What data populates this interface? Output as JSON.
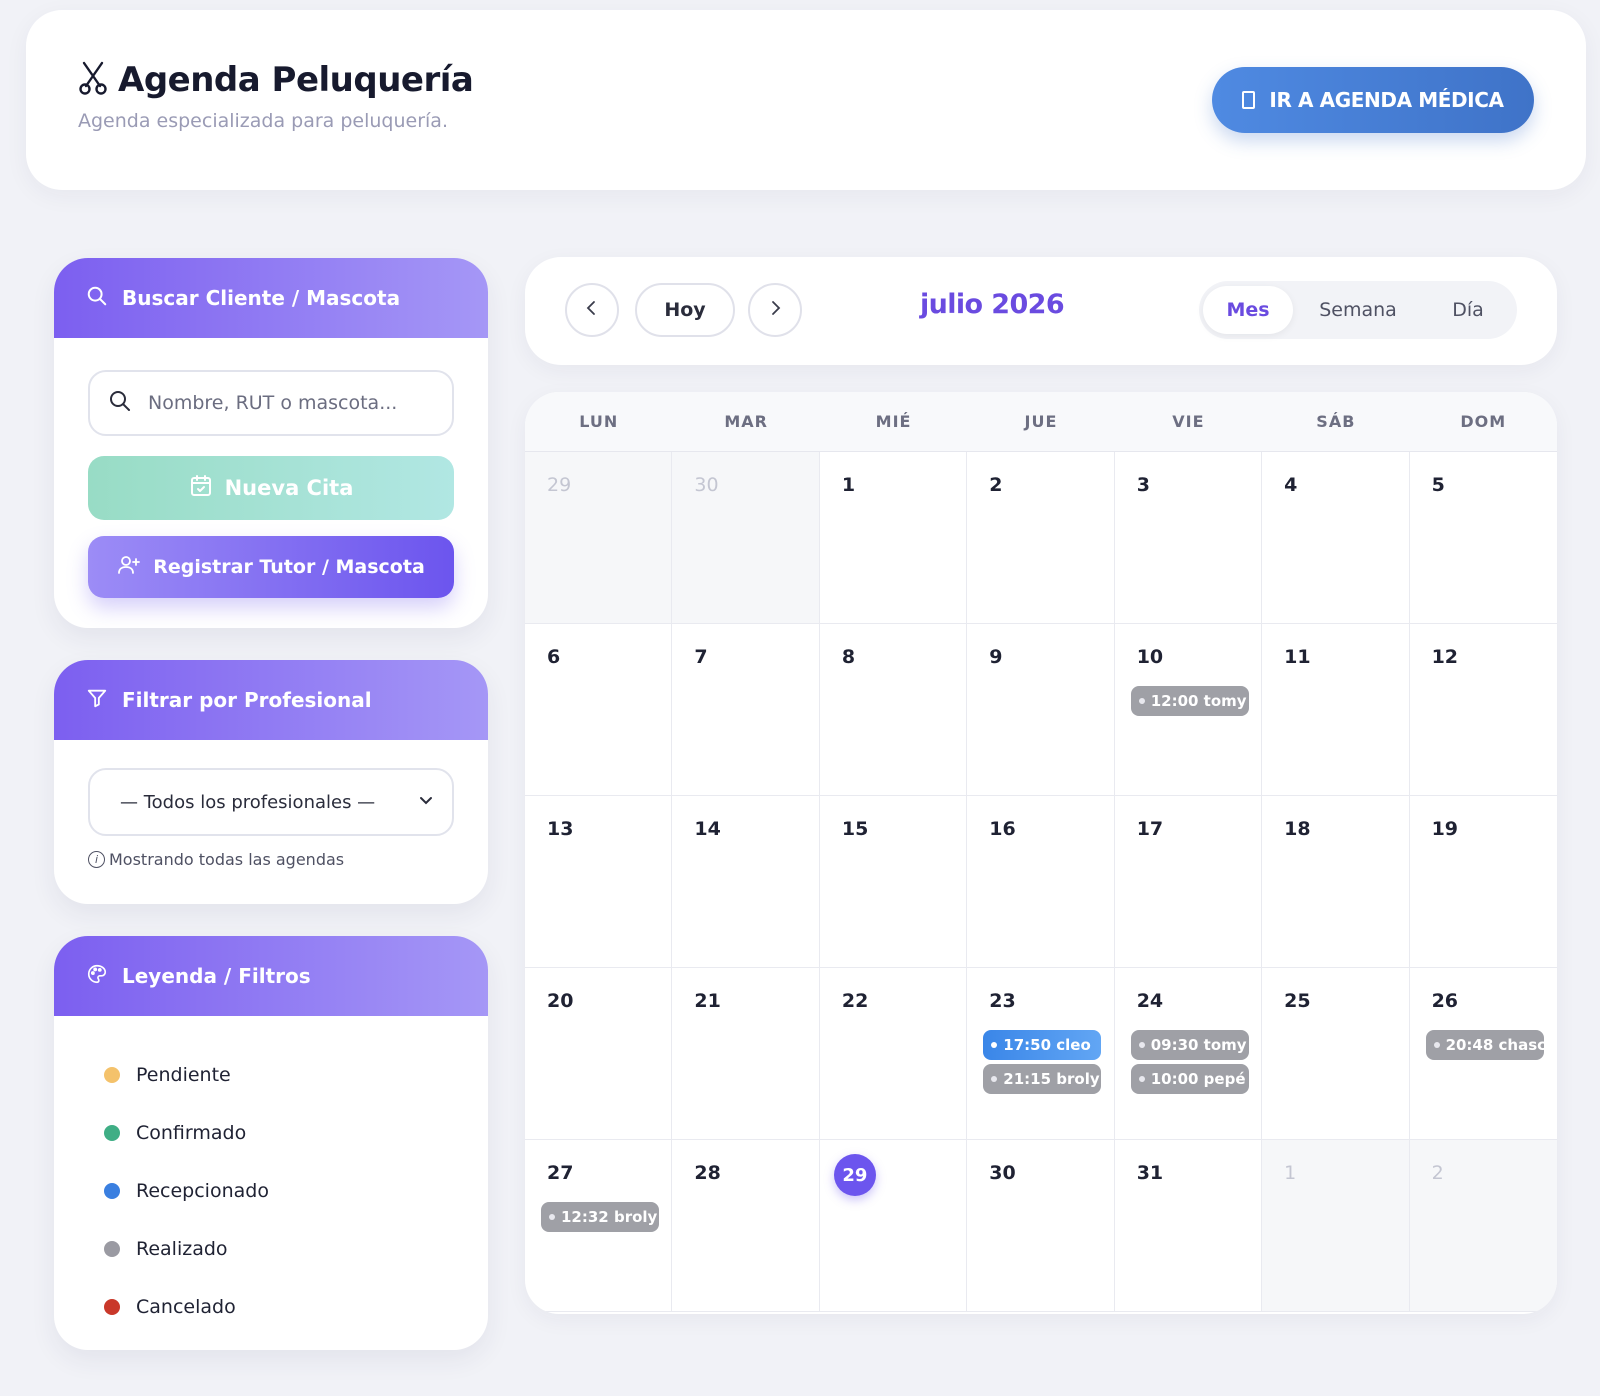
{
  "header": {
    "title": "Agenda Peluquería",
    "subtitle": "Agenda especializada para peluquería.",
    "medical_button": "IR A AGENDA MÉDICA"
  },
  "search_panel": {
    "title": "Buscar Cliente / Mascota",
    "placeholder": "Nombre, RUT o mascota...",
    "new_appointment": "Nueva Cita",
    "register": "Registrar Tutor / Mascota"
  },
  "filter_panel": {
    "title": "Filtrar por Profesional",
    "selected": "— Todos los profesionales —",
    "note": "Mostrando todas las agendas"
  },
  "legend_panel": {
    "title": "Leyenda / Filtros",
    "items": [
      {
        "label": "Pendiente",
        "color": "#f4c26b"
      },
      {
        "label": "Confirmado",
        "color": "#3fae85"
      },
      {
        "label": "Recepcionado",
        "color": "#3a7fe0"
      },
      {
        "label": "Realizado",
        "color": "#9a9aa2"
      },
      {
        "label": "Cancelado",
        "color": "#c9382a"
      }
    ]
  },
  "toolbar": {
    "today": "Hoy",
    "month_label": "julio 2026",
    "views": [
      "Mes",
      "Semana",
      "Día"
    ],
    "active_view": "Mes"
  },
  "calendar": {
    "weekdays": [
      "LUN",
      "MAR",
      "MIÉ",
      "JUE",
      "VIE",
      "SÁB",
      "DOM"
    ],
    "days": [
      "29",
      "30",
      "1",
      "2",
      "3",
      "4",
      "5",
      "6",
      "7",
      "8",
      "9",
      "10",
      "11",
      "12",
      "13",
      "14",
      "15",
      "16",
      "17",
      "18",
      "19",
      "20",
      "21",
      "22",
      "23",
      "24",
      "25",
      "26",
      "27",
      "28",
      "29",
      "30",
      "31",
      "1",
      "2"
    ],
    "other_month": [
      0,
      1,
      33,
      34
    ],
    "today_index": 30,
    "events": [
      {
        "day_index": 11,
        "label": "12:00 tomy",
        "status": "Realizado"
      },
      {
        "day_index": 24,
        "label": "17:50 cleo",
        "status": "Recepcionado"
      },
      {
        "day_index": 24,
        "label": "21:15 broly",
        "status": "Realizado"
      },
      {
        "day_index": 25,
        "label": "09:30 tomy",
        "status": "Realizado"
      },
      {
        "day_index": 25,
        "label": "10:00 pepé",
        "status": "Realizado"
      },
      {
        "day_index": 27,
        "label": "20:48 chasc",
        "status": "Realizado"
      },
      {
        "day_index": 28,
        "label": "12:32 broly",
        "status": "Realizado"
      }
    ]
  }
}
